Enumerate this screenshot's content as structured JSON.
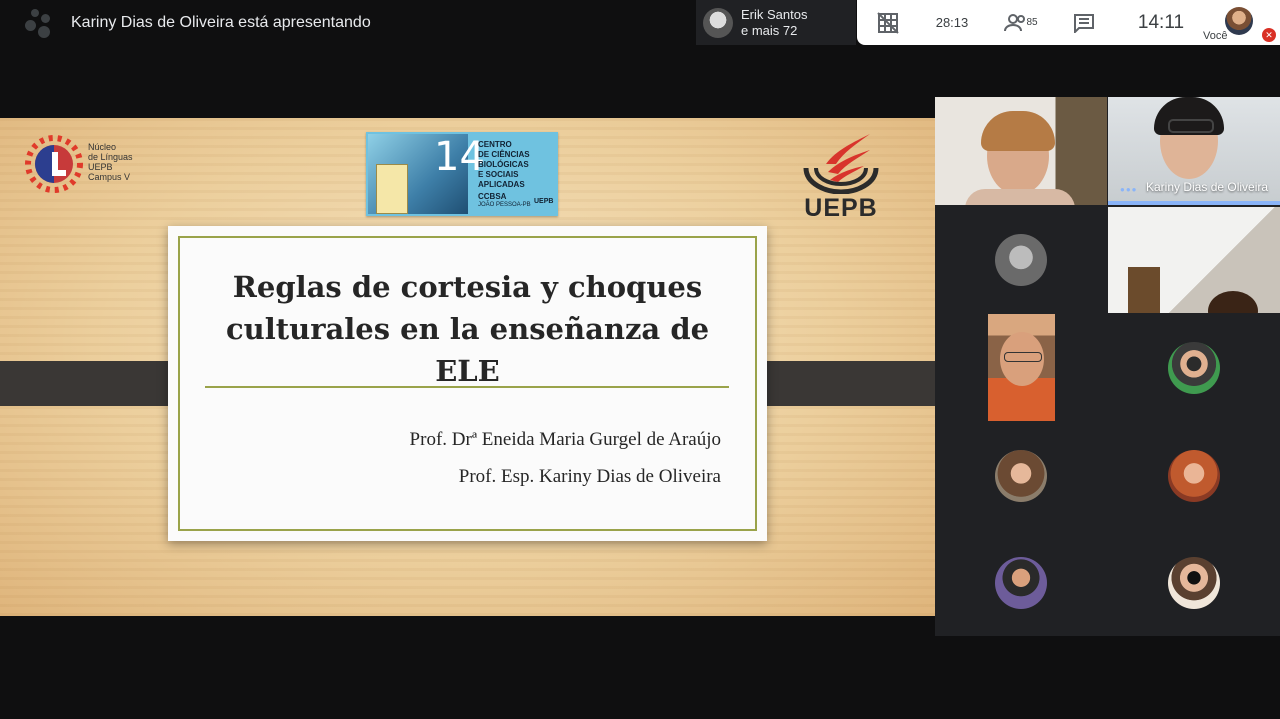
{
  "topbar": {
    "presenting_title": "Kariny Dias de Oliveira está apresentando",
    "speaker_name": "Erik Santos",
    "speaker_others": "e mais 72"
  },
  "controls": {
    "layout_icon": "grid-off-icon",
    "timer": "28:13",
    "people_count": "85",
    "chat_icon": "chat-icon",
    "clock": "14:11",
    "you_label": "Você"
  },
  "slide": {
    "title_line1": "Reglas de cortesia y choques",
    "title_line2": "culturales en la enseñanza de",
    "title_line3": "ELE",
    "author1": "Prof. Drª Eneida Maria Gurgel de Araújo",
    "author2": "Prof. Esp. Kariny Dias de Oliveira",
    "nucleo_logo_text": [
      "Núcleo",
      "de Línguas",
      "UEPB",
      "Campus V"
    ],
    "ccbsa": {
      "number": "14",
      "lines": [
        "CENTRO",
        "DE CIÊNCIAS",
        "BIOLÓGICAS",
        "E SOCIAIS",
        "APLICADAS"
      ],
      "footer": "CCBSA",
      "footer_small": "JOÃO PESSOA-PB",
      "uepb_mini": "UEPB"
    },
    "uepb_logo_text": "UEPB"
  },
  "participants": {
    "active_name": "Kariny Dias de Oliveira"
  },
  "colors": {
    "accent": "#8ab4f8",
    "mic_off": "#d93025",
    "slide_border": "#9aa34a"
  }
}
